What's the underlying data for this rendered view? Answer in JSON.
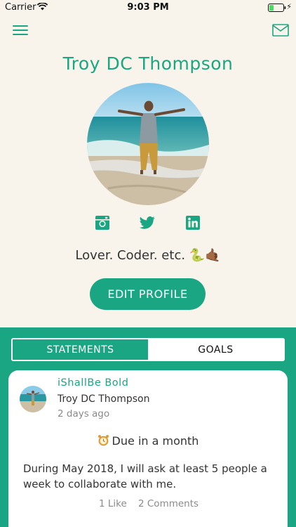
{
  "status_bar": {
    "carrier": "Carrier",
    "time": "9:03 PM"
  },
  "profile": {
    "name": "Troy DC Thompson",
    "bio": "Lover. Coder. etc. 🐍🤙🏾",
    "edit_label": "EDIT PROFILE"
  },
  "social": [
    "instagram-icon",
    "twitter-icon",
    "linkedin-icon"
  ],
  "tabs": [
    {
      "label": "STATEMENTS",
      "active": true
    },
    {
      "label": "GOALS",
      "active": false
    }
  ],
  "statement_card": {
    "title": "iShallBe Bold",
    "author": "Troy DC Thompson",
    "time": "2 days ago",
    "due": "Due in a month",
    "text": "During May 2018, I will ask at least 5 people a week to collaborate with me.",
    "likes": "1 Like",
    "comments": "2 Comments"
  },
  "colors": {
    "accent": "#1aa683",
    "background": "#f8f4ec"
  }
}
